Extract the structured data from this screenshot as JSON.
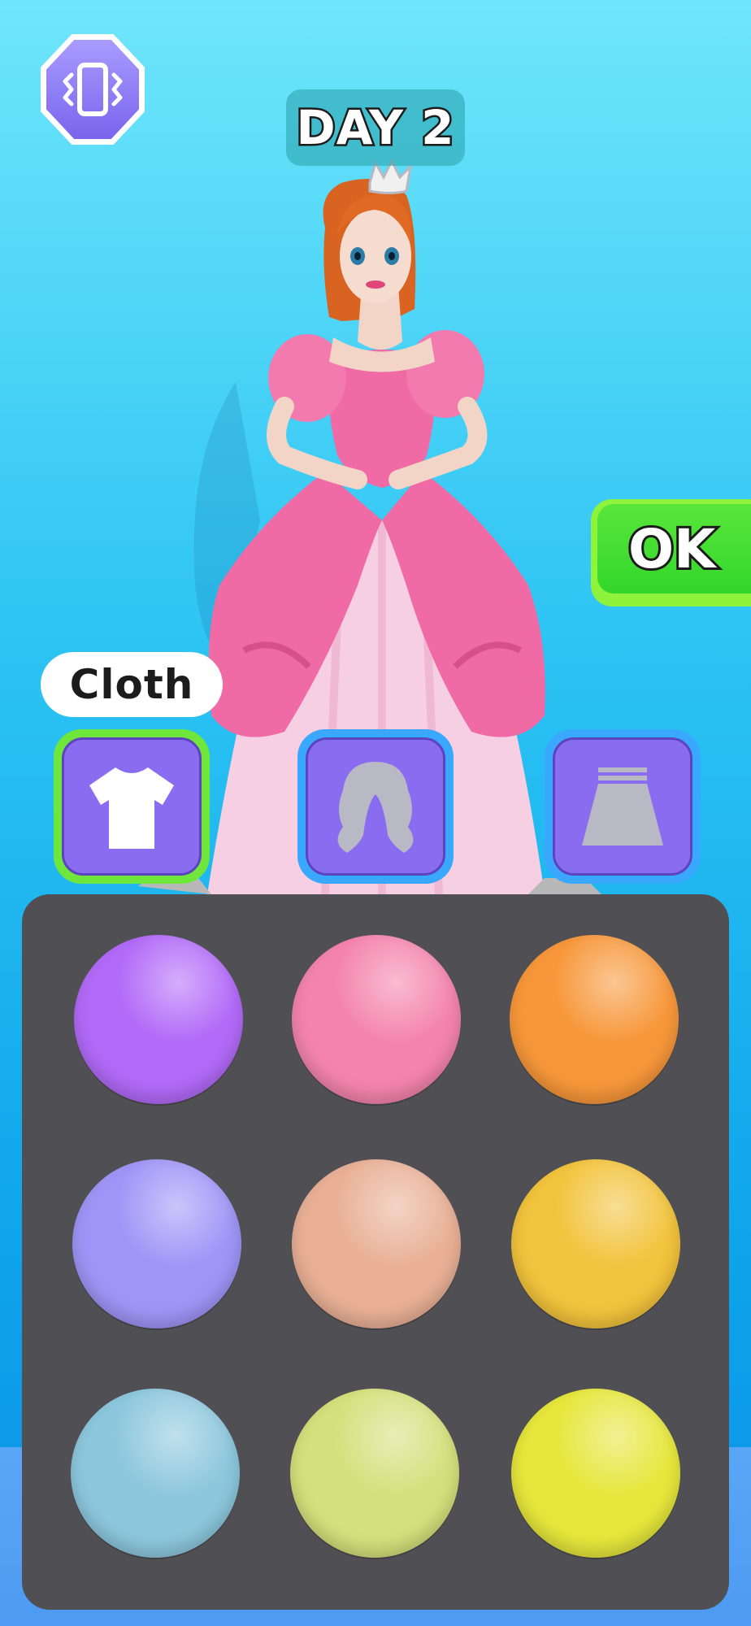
{
  "hud": {
    "vibration_icon": "vibration-phone-icon",
    "day_label": "DAY 2",
    "ok_label": "OK"
  },
  "category": {
    "selected_label": "Cloth",
    "buttons": [
      {
        "name": "clothes",
        "icon": "tshirt-icon",
        "selected": true
      },
      {
        "name": "hair",
        "icon": "hair-icon",
        "selected": false
      },
      {
        "name": "skirt",
        "icon": "skirt-icon",
        "selected": false
      }
    ]
  },
  "palette": {
    "colors": [
      "#b26af8",
      "#f484ab",
      "#f7973a",
      "#9f95f7",
      "#e9b096",
      "#f2c33c",
      "#8dc7dd",
      "#d4e07c",
      "#e6e63c"
    ]
  }
}
